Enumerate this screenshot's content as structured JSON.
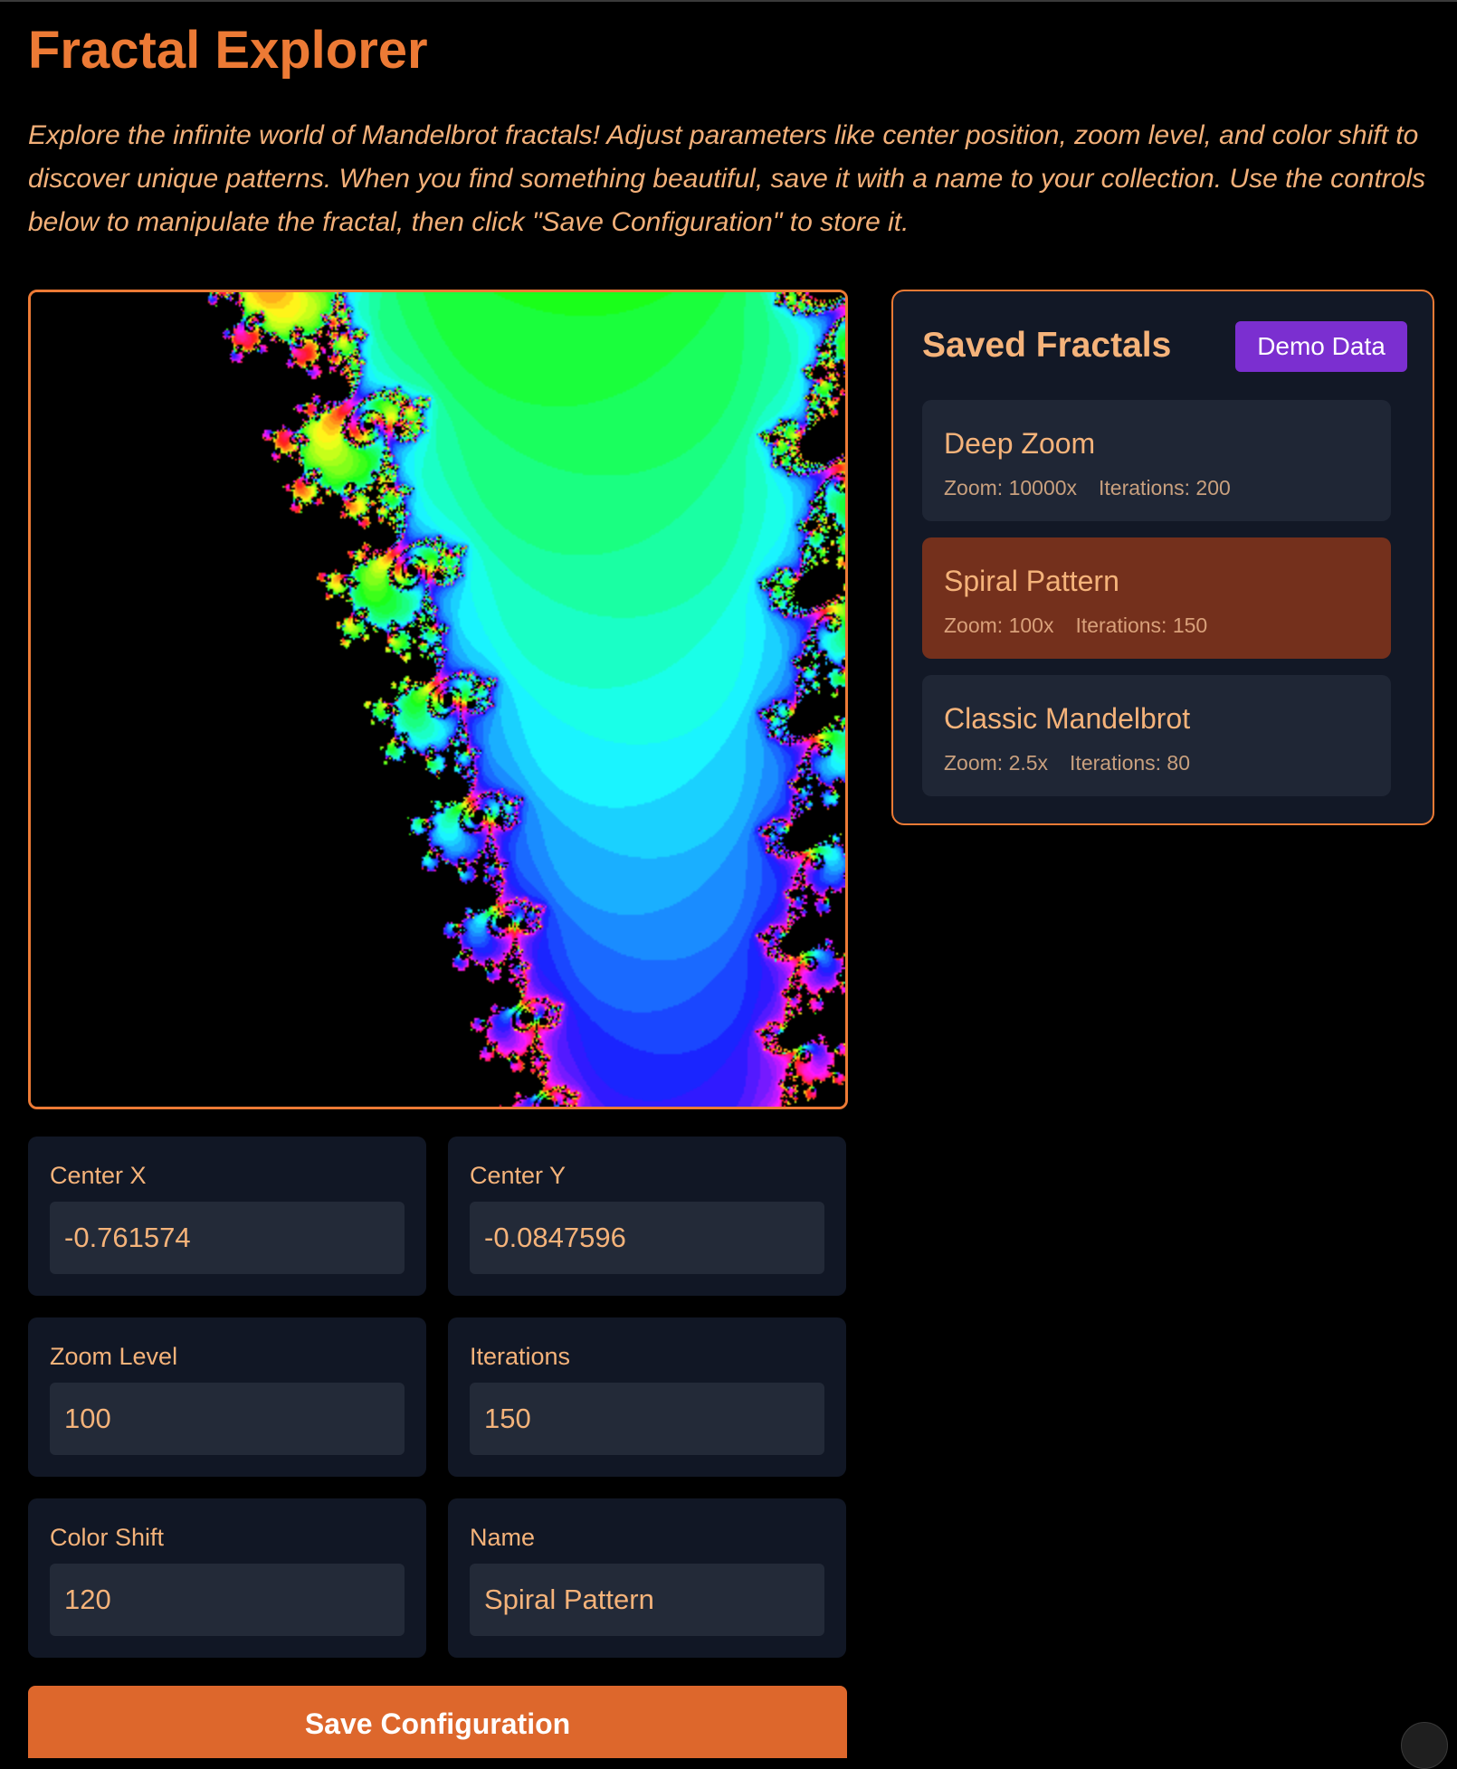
{
  "header": {
    "title": "Fractal Explorer",
    "intro": "Explore the infinite world of Mandelbrot fractals! Adjust parameters like center position, zoom level, and color shift to discover unique patterns. When you find something beautiful, save it with a name to your collection. Use the controls below to manipulate the fractal, then click \"Save Configuration\" to store it."
  },
  "saved": {
    "title": "Saved Fractals",
    "demo_label": "Demo Data",
    "items": [
      {
        "name": "Deep Zoom",
        "zoom": "Zoom: 10000x",
        "iterations": "Iterations: 200",
        "active": false
      },
      {
        "name": "Spiral Pattern",
        "zoom": "Zoom: 100x",
        "iterations": "Iterations: 150",
        "active": true
      },
      {
        "name": "Classic Mandelbrot",
        "zoom": "Zoom: 2.5x",
        "iterations": "Iterations: 80",
        "active": false
      }
    ]
  },
  "controls": {
    "center_x": {
      "label": "Center X",
      "value": "-0.761574"
    },
    "center_y": {
      "label": "Center Y",
      "value": "-0.0847596"
    },
    "zoom": {
      "label": "Zoom Level",
      "value": "100"
    },
    "iterations": {
      "label": "Iterations",
      "value": "150"
    },
    "color_shift": {
      "label": "Color Shift",
      "value": "120"
    },
    "name": {
      "label": "Name",
      "value": "Spiral Pattern"
    }
  },
  "save_label": "Save Configuration",
  "colors": {
    "accent": "#ec7a35",
    "text": "#f5b37a",
    "panel_bg": "#121826",
    "active_card": "#74301c",
    "demo_button": "#7b2fd0",
    "save_button": "#dd672c"
  },
  "icons": {
    "corner": "refresh-icon"
  }
}
